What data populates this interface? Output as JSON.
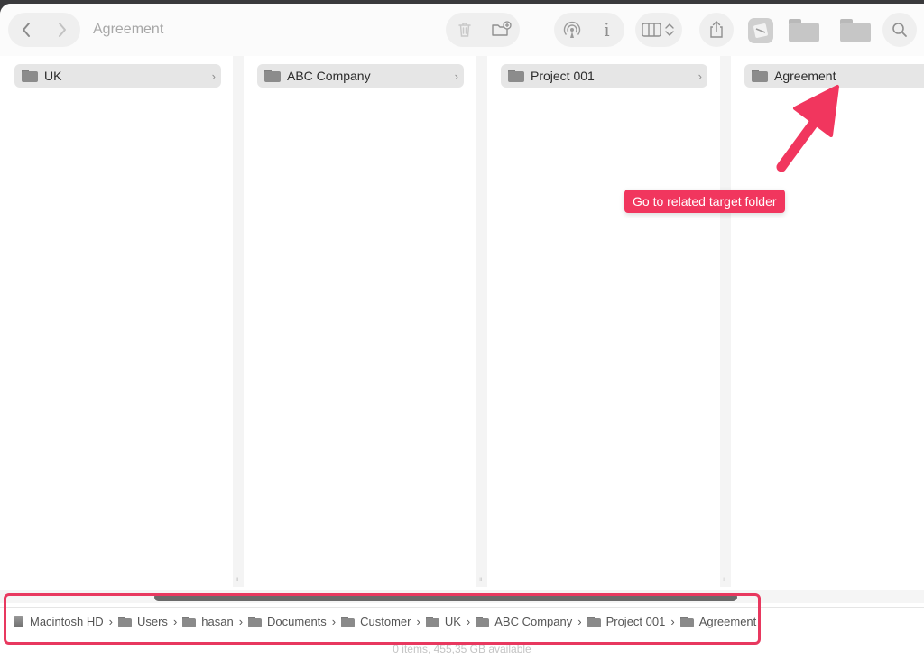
{
  "window": {
    "title": "Agreement"
  },
  "toolbar": {
    "back_icon": "chevron-left-icon",
    "forward_icon": "chevron-right-icon",
    "info_label": "i"
  },
  "columns": [
    {
      "folder": "UK"
    },
    {
      "folder": "ABC Company"
    },
    {
      "folder": "Project 001"
    },
    {
      "folder": "Agreement"
    }
  ],
  "annotation": {
    "callout": "Go to related target folder",
    "color": "#f1365e"
  },
  "pathbar": {
    "items": [
      "Macintosh HD",
      "Users",
      "hasan",
      "Documents",
      "Customer",
      "UK",
      "ABC Company",
      "Project 001",
      "Agreement"
    ]
  },
  "status": {
    "text": "0 items, 455,35 GB available"
  }
}
